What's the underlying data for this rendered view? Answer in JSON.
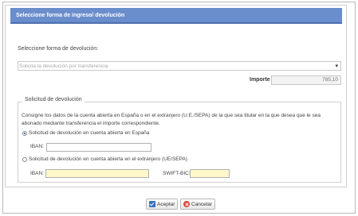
{
  "header": {
    "title": "Seleccione forma de ingreso/ devolución"
  },
  "method": {
    "label": "Seleccione forma de devolución:",
    "selected": "Solicita la devolución por transferencia"
  },
  "importe": {
    "label": "Importe",
    "value": "785,10"
  },
  "solicitud": {
    "legend": "Solicitud de devolución",
    "description": "Consigne los datos de la cuenta abierta en España o en el extranjero (U.E./SEPA) de la que sea titular en la que desea que le sea abonado mediante transferencia el importe correspondiente.",
    "option_spain": "Solicitud de devolución en cuenta abierta en España",
    "iban_label": "IBAN:",
    "option_foreign": "Solicitud de devolución en cuenta abierta en el extranjero (UE/SEPA)",
    "iban2_label": "IBAN:",
    "swift_label": "SWIFT-BIC:"
  },
  "buttons": {
    "accept": "Aceptar",
    "cancel": "Cancelar"
  },
  "colors": {
    "header_bg": "#6a8dcc",
    "foreign_field_bg": "#fff8c8"
  }
}
